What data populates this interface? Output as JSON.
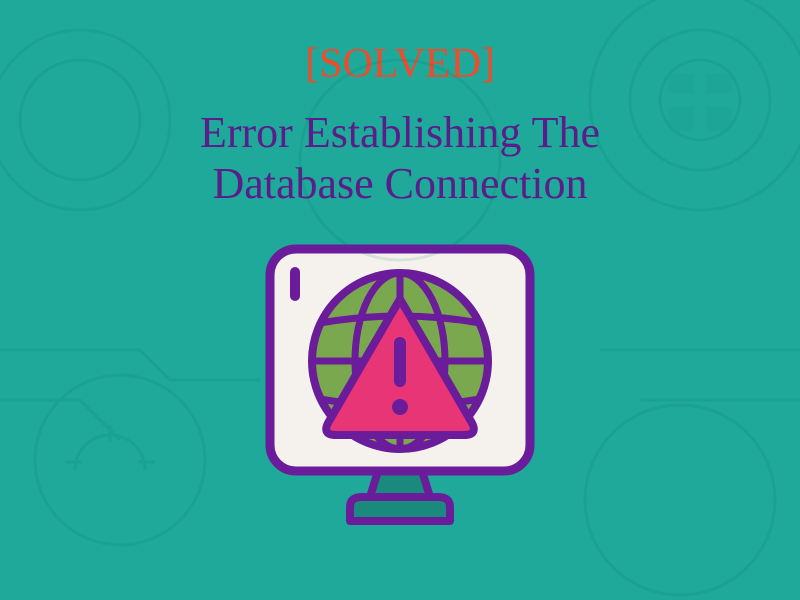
{
  "badge_text": "[SOLVED]",
  "heading_line1": "Error Establishing The",
  "heading_line2": "Database Connection",
  "colors": {
    "background": "#1ea99a",
    "badge": "#f24a2a",
    "heading": "#5a1d8a",
    "illustration_outline": "#6b1c9a",
    "globe_fill": "#7aa84e",
    "warning_fill": "#e73575",
    "screen_fill": "#f5f2ed"
  },
  "icon_names": {
    "main": "monitor-globe-warning-icon"
  }
}
